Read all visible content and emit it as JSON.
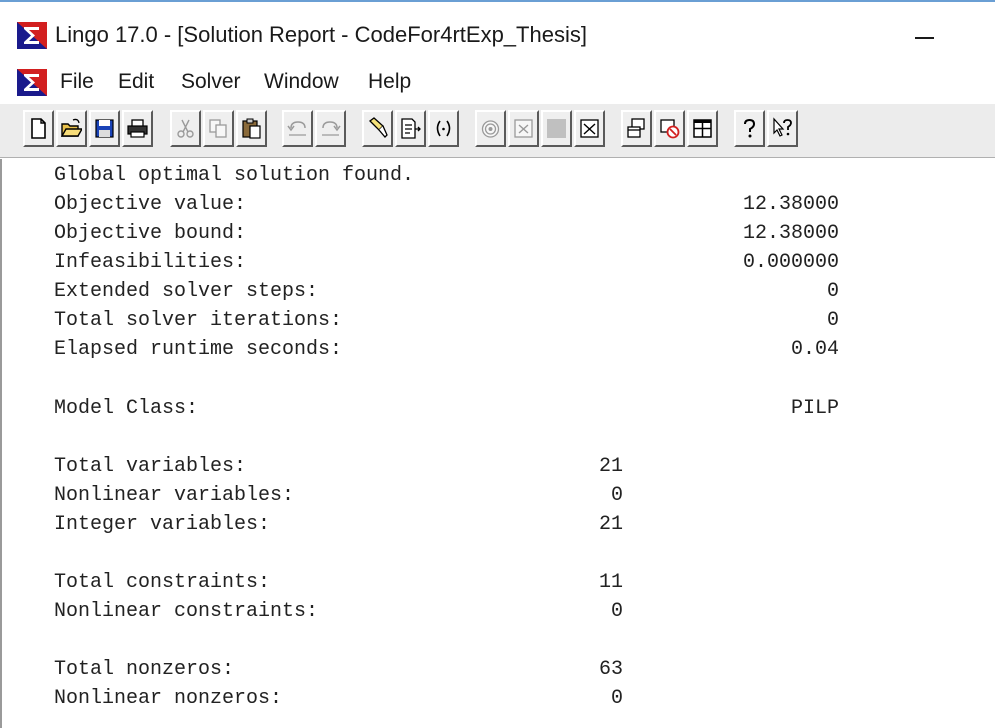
{
  "window": {
    "title": "Lingo 17.0 - [Solution Report - CodeFor4rtExp_Thesis]"
  },
  "menu": {
    "items": [
      "File",
      "Edit",
      "Solver",
      "Window",
      "Help"
    ]
  },
  "toolbar": {
    "buttons": [
      {
        "icon": "new-document-icon"
      },
      {
        "icon": "open-folder-icon"
      },
      {
        "icon": "save-icon"
      },
      {
        "icon": "print-icon"
      },
      {
        "icon": "cut-icon"
      },
      {
        "icon": "copy-icon"
      },
      {
        "icon": "paste-icon"
      },
      {
        "icon": "undo-icon"
      },
      {
        "icon": "redo-icon"
      },
      {
        "icon": "find-icon"
      },
      {
        "icon": "goto-line-icon"
      },
      {
        "icon": "match-parenthesis-icon"
      },
      {
        "icon": "solve-icon"
      },
      {
        "icon": "close-window-icon"
      },
      {
        "icon": "stop-icon"
      },
      {
        "icon": "options-icon"
      },
      {
        "icon": "send-to-back-icon"
      },
      {
        "icon": "close-all-icon"
      },
      {
        "icon": "tile-windows-icon"
      },
      {
        "icon": "help-icon"
      },
      {
        "icon": "context-help-icon"
      }
    ]
  },
  "report": {
    "status": "Global optimal solution found.",
    "solver_stats": [
      {
        "label": "Objective value:",
        "value": "12.38000"
      },
      {
        "label": "Objective bound:",
        "value": "12.38000"
      },
      {
        "label": "Infeasibilities:",
        "value": "0.000000"
      },
      {
        "label": "Extended solver steps:",
        "value": "0"
      },
      {
        "label": "Total solver iterations:",
        "value": "0"
      },
      {
        "label": "Elapsed runtime seconds:",
        "value": "0.04"
      }
    ],
    "model_class": {
      "label": "Model Class:",
      "value": "PILP"
    },
    "variables": [
      {
        "label": "Total variables:",
        "value": "21"
      },
      {
        "label": "Nonlinear variables:",
        "value": "0"
      },
      {
        "label": "Integer variables:",
        "value": "21"
      }
    ],
    "constraints": [
      {
        "label": "Total constraints:",
        "value": "11"
      },
      {
        "label": "Nonlinear constraints:",
        "value": "0"
      }
    ],
    "nonzeros": [
      {
        "label": "Total nonzeros:",
        "value": "63"
      },
      {
        "label": "Nonlinear nonzeros:",
        "value": "0"
      }
    ]
  },
  "colors": {
    "accent_blue": "#1a43b8",
    "accent_red": "#d21f1f",
    "toolbar_bg": "#ececec"
  }
}
